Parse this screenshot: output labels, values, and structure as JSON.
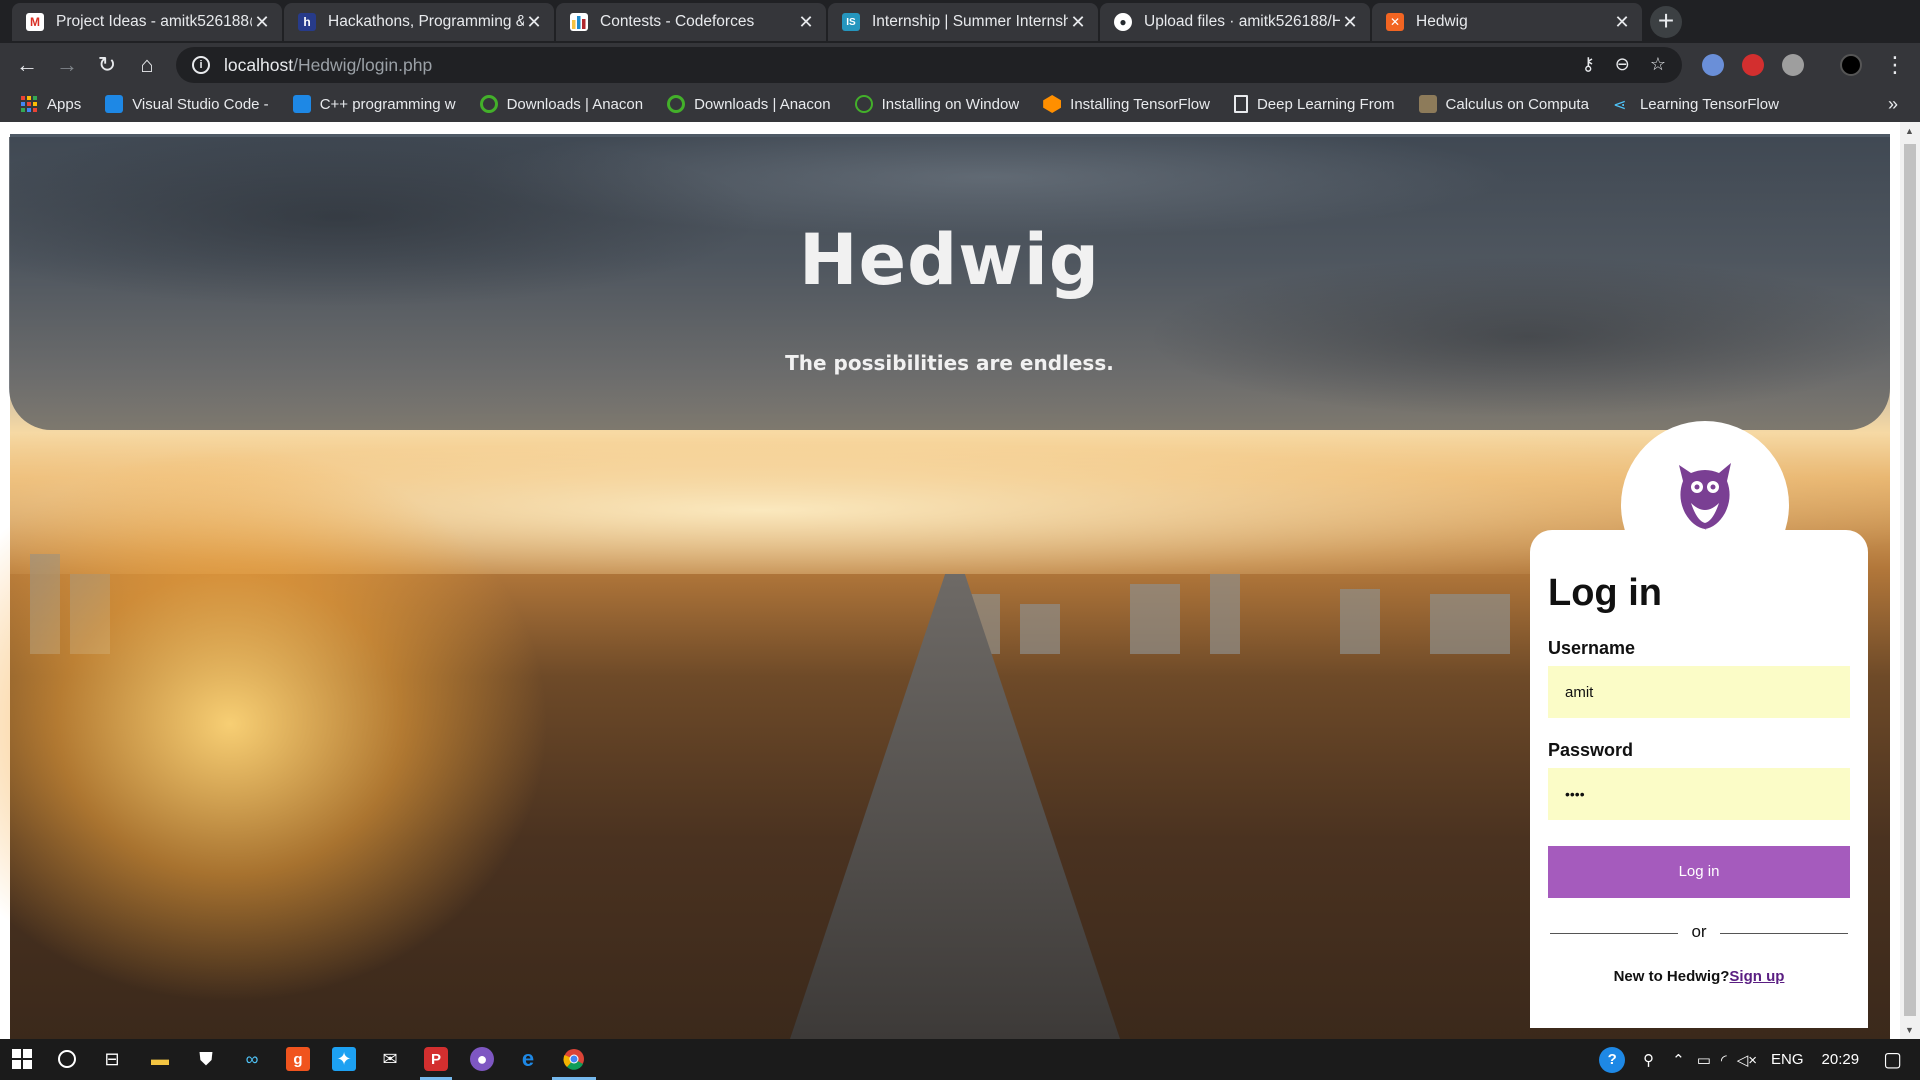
{
  "browser": {
    "tabs": [
      {
        "title": "Project Ideas - amitk526188@",
        "favicon_color": "#d93025",
        "favicon_glyph": "M"
      },
      {
        "title": "Hackathons, Programming &",
        "favicon_color": "#273b8a",
        "favicon_glyph": "h"
      },
      {
        "title": "Contests - Codeforces",
        "favicon_color": "#1f8acb",
        "favicon_glyph": "▮"
      },
      {
        "title": "Internship | Summer Internsh",
        "favicon_color": "#2596be",
        "favicon_glyph": "IS"
      },
      {
        "title": "Upload files · amitk526188/H",
        "favicon_color": "#24292e",
        "favicon_glyph": "◉"
      },
      {
        "title": "Hedwig",
        "favicon_color": "#f26522",
        "favicon_glyph": "⊠"
      }
    ],
    "address": {
      "host": "localhost",
      "path": "/Hedwig/login.php"
    },
    "bookmarks": [
      {
        "label": "Apps",
        "icon_color": "#ea4335"
      },
      {
        "label": "Visual Studio Code -",
        "icon_color": "#1e88e5"
      },
      {
        "label": "C++ programming w",
        "icon_color": "#1e88e5"
      },
      {
        "label": "Downloads | Anacon",
        "icon_color": "#43b02a"
      },
      {
        "label": "Downloads | Anacon",
        "icon_color": "#43b02a"
      },
      {
        "label": "Installing on Window",
        "icon_color": "#43b02a"
      },
      {
        "label": "Installing TensorFlow",
        "icon_color": "#ff8f00"
      },
      {
        "label": "Deep Learning From",
        "icon_color": "#e8eaed"
      },
      {
        "label": "Calculus on Computa",
        "icon_color": "#8d7b5a"
      },
      {
        "label": "Learning TensorFlow",
        "icon_color": "#4fc3f7"
      }
    ]
  },
  "page": {
    "site_title": "Hedwig",
    "tagline": "The possibilities are endless.",
    "login": {
      "heading": "Log in",
      "username_label": "Username",
      "username_value": "amit",
      "password_label": "Password",
      "password_value": "••••",
      "submit_label": "Log in",
      "divider": "or",
      "signup_prompt": "New to Hedwig?",
      "signup_link": "Sign up"
    },
    "colors": {
      "accent": "#a55bbd",
      "input_bg": "#fbfcc7",
      "logo": "#7a3f93"
    }
  },
  "taskbar": {
    "language": "ENG",
    "time": "20:29"
  }
}
